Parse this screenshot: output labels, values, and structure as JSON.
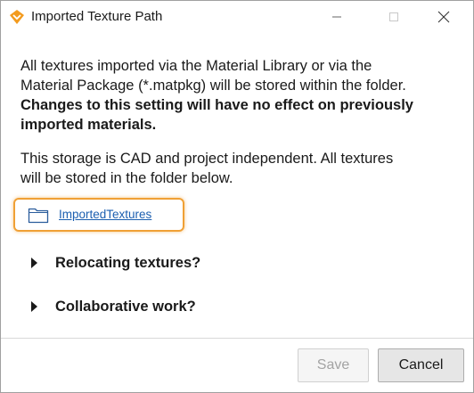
{
  "window": {
    "title": "Imported Texture Path",
    "app_icon": "orange-diamond-icon",
    "controls": {
      "minimize": "minimize-icon",
      "maximize": "maximize-icon",
      "close": "close-icon"
    }
  },
  "content": {
    "paragraph1_line1": "All textures imported via the Material Library or via the",
    "paragraph1_line2": "Material Package (*.matpkg) will be stored within the folder.",
    "paragraph1_bold_line1": "Changes to this setting will have no effect on previously",
    "paragraph1_bold_line2": "imported materials.",
    "paragraph2_line1": "This storage is CAD and project independent. All textures",
    "paragraph2_line2": "will be stored in the folder below.",
    "folder_link": {
      "label": "ImportedTextures",
      "icon": "folder-icon"
    },
    "expanders": [
      {
        "label": "Relocating textures?",
        "icon": "expand-arrow-icon"
      },
      {
        "label": "Collaborative work?",
        "icon": "expand-arrow-icon"
      }
    ]
  },
  "footer": {
    "save_label": "Save",
    "cancel_label": "Cancel"
  },
  "colors": {
    "highlight_border": "#f0a035",
    "link": "#1c5fb0",
    "app_icon": "#f39b1e"
  }
}
